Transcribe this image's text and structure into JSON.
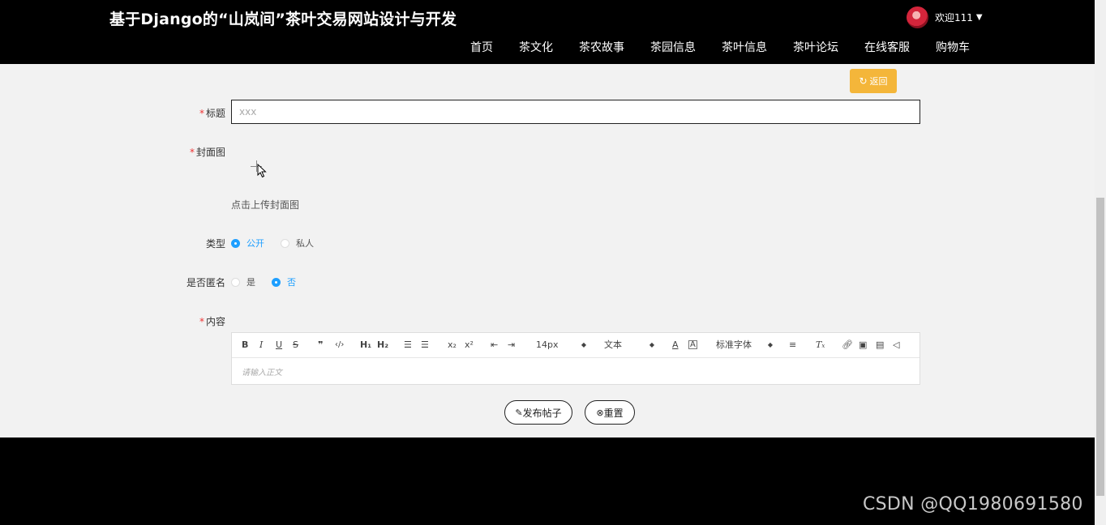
{
  "header": {
    "title": "基于Django的“山岚间”茶叶交易网站设计与开发",
    "user_label": "欢迎111",
    "nav": [
      "首页",
      "茶文化",
      "茶农故事",
      "茶园信息",
      "茶叶信息",
      "茶叶论坛",
      "在线客服",
      "购物车"
    ]
  },
  "toolbar": {
    "back_label": "返回"
  },
  "form": {
    "title_label": "标题",
    "title_placeholder": "xxx",
    "cover_label": "封面图",
    "cover_hint": "点击上传封面图",
    "type_label": "类型",
    "type_options": [
      "公开",
      "私人"
    ],
    "type_selected": "公开",
    "anon_label": "是否匿名",
    "anon_options": [
      "是",
      "否"
    ],
    "anon_selected": "否",
    "content_label": "内容"
  },
  "editor": {
    "font_size": "14px",
    "block_format": "文本",
    "font_family": "标准字体",
    "placeholder": "请输入正文"
  },
  "actions": {
    "publish_label": "发布帖子",
    "reset_label": "重置"
  },
  "watermark": "CSDN @QQ1980691580",
  "colors": {
    "accent": "#1e9fff",
    "back_button": "#f4b63a",
    "header_bg": "#000000",
    "required": "#ee3333"
  }
}
